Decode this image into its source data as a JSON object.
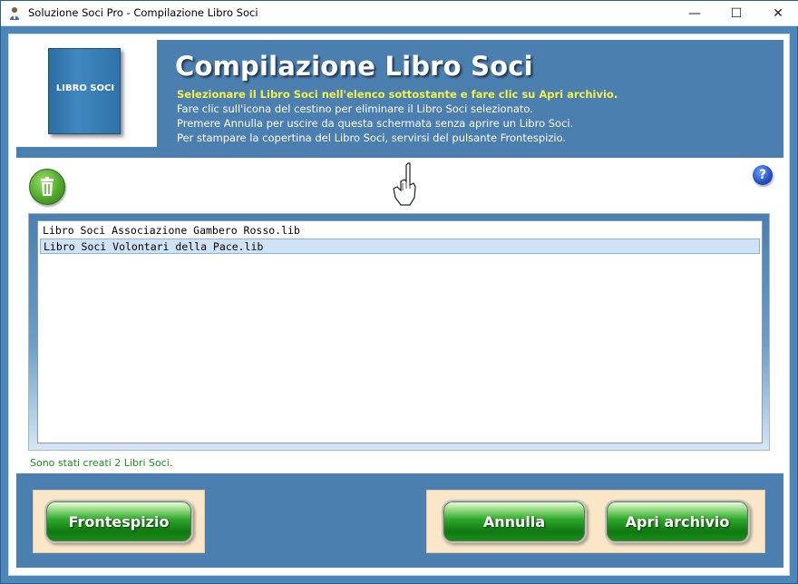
{
  "window": {
    "title": "Soluzione Soci Pro - Compilazione Libro Soci",
    "minimize_glyph": "—",
    "maximize_glyph": "☐",
    "close_glyph": "✕"
  },
  "header": {
    "logo_text": "LIBRO SOCI",
    "title": "Compilazione Libro Soci",
    "instruction_highlight": "Selezionare il Libro Soci nell'elenco sottostante e fare clic su Apri archivio.",
    "instructions": [
      "Fare clic sull'icona del cestino per eliminare il Libro Soci selezionato.",
      "Premere Annulla per uscire da questa schermata senza aprire un Libro Soci.",
      "Per stampare la copertina del Libro Soci, servirsi del pulsante Frontespizio."
    ]
  },
  "toolbar": {
    "trash_icon": "trash-icon",
    "pointer_icon": "hand-pointer-icon",
    "help_label": "?"
  },
  "list": {
    "items": [
      "Libro Soci Associazione Gambero Rosso.lib",
      "Libro Soci Volontari della Pace.lib"
    ],
    "selected_index": 1
  },
  "status": {
    "text": "Sono stati creati 2 Libri Soci."
  },
  "buttons": {
    "frontespizio": "Frontespizio",
    "annulla": "Annulla",
    "apri_archivio": "Apri archivio"
  },
  "colors": {
    "band_blue": "#4a7fb0",
    "highlight_yellow": "#f4f04a",
    "status_green": "#1e8a1e",
    "button_green": "#2ea82a",
    "button_frame": "#fae6c8"
  }
}
